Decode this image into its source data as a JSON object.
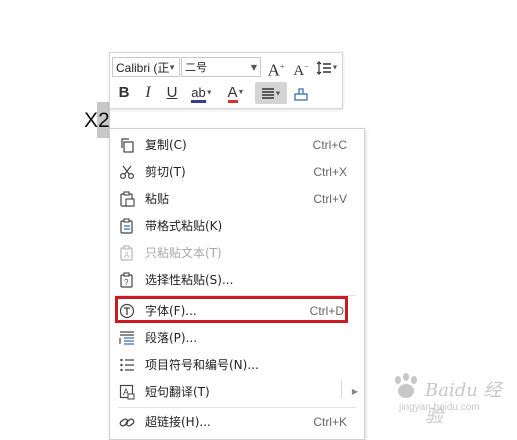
{
  "document": {
    "text": "X2"
  },
  "mini_toolbar": {
    "font_name": "Calibri (正",
    "font_size": "二号",
    "grow_font": "A",
    "shrink_font": "A",
    "bold": "B",
    "italic": "I",
    "underline": "U",
    "highlight": "ab",
    "font_color": "A",
    "highlight_color": "#3b3b8f",
    "font_color_value": "#d4322b"
  },
  "context_menu": {
    "items": [
      {
        "label": "复制(C)",
        "shortcut": "Ctrl+C",
        "icon": "copy-icon"
      },
      {
        "label": "剪切(T)",
        "shortcut": "Ctrl+X",
        "icon": "cut-icon"
      },
      {
        "label": "粘贴",
        "shortcut": "Ctrl+V",
        "icon": "paste-icon"
      },
      {
        "label": "带格式粘贴(K)",
        "shortcut": "",
        "icon": "paste-format-icon"
      },
      {
        "label": "只粘贴文本(T)",
        "shortcut": "",
        "icon": "paste-text-icon",
        "disabled": true
      },
      {
        "label": "选择性粘贴(S)...",
        "shortcut": "",
        "icon": "paste-special-icon"
      },
      {
        "label": "字体(F)...",
        "shortcut": "Ctrl+D",
        "icon": "font-icon",
        "highlighted": true
      },
      {
        "label": "段落(P)...",
        "shortcut": "",
        "icon": "paragraph-icon"
      },
      {
        "label": "项目符号和编号(N)...",
        "shortcut": "",
        "icon": "bullets-icon"
      },
      {
        "label": "短句翻译(T)",
        "shortcut": "",
        "icon": "translate-icon",
        "submenu": true
      },
      {
        "label": "超链接(H)...",
        "shortcut": "Ctrl+K",
        "icon": "link-icon"
      }
    ],
    "highlight_color": "#cc1a22"
  },
  "watermark": {
    "brand": "Baidu 经验",
    "url": "jingyan.baidu.com"
  }
}
